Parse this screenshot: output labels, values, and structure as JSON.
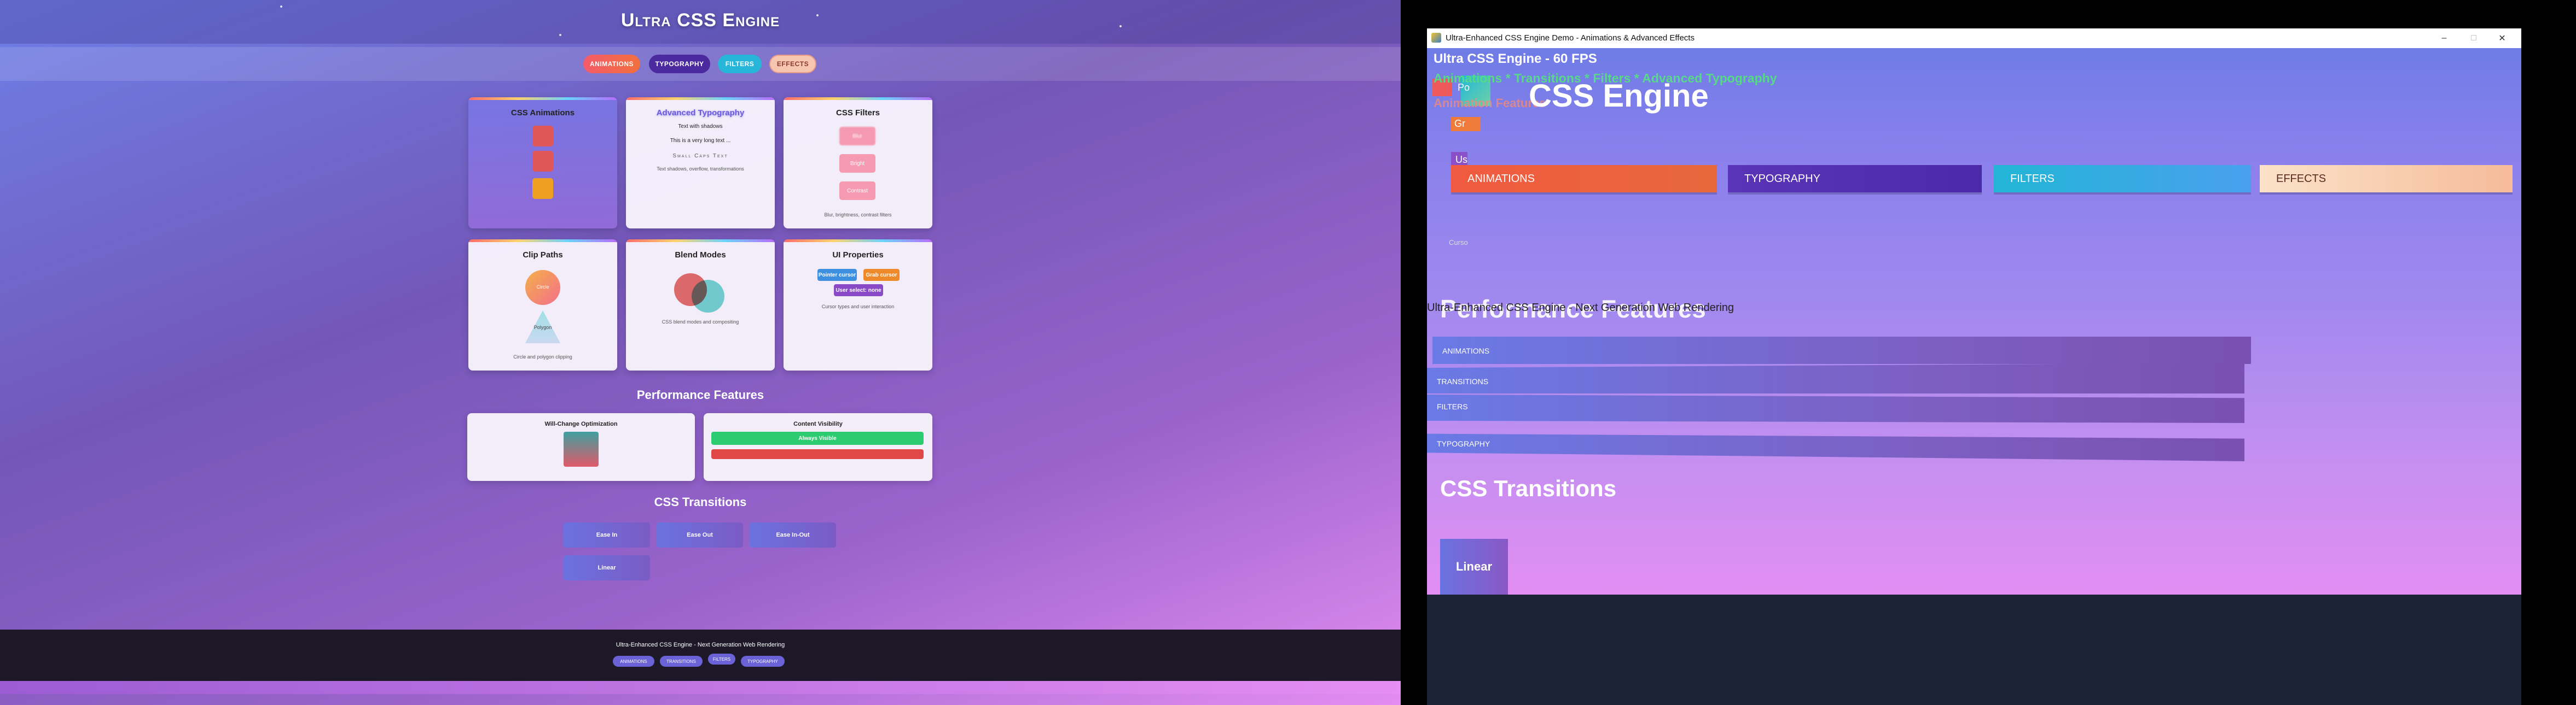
{
  "left_page": {
    "title": "Ultra CSS Engine",
    "nav": [
      "ANIMATIONS",
      "TYPOGRAPHY",
      "FILTERS",
      "EFFECTS"
    ],
    "cards": {
      "animations": {
        "title": "CSS Animations"
      },
      "typography": {
        "title": "Advanced Typography",
        "lines": [
          "Text with shadows",
          "This is a very long text ...",
          "Small Caps Text",
          "Text shadows, overflow, transformations"
        ]
      },
      "filters": {
        "title": "CSS Filters",
        "boxes": [
          "Blur",
          "Bright",
          "Contrast"
        ],
        "caption": "Blur, brightness, contrast filters"
      },
      "clip": {
        "title": "Clip Paths",
        "circle": "Circle",
        "polygon": "Polygon",
        "caption": "Circle and polygon clipping"
      },
      "blend": {
        "title": "Blend Modes",
        "caption": "CSS blend modes and compositing"
      },
      "ui": {
        "title": "UI Properties",
        "buttons": [
          "Pointer cursor",
          "Grab cursor",
          "User select: none"
        ],
        "caption": "Cursor types and user interaction"
      }
    },
    "performance": {
      "heading": "Performance Features",
      "will_change": {
        "title": "Will-Change Optimization"
      },
      "visibility": {
        "title": "Content Visibility",
        "always": "Always Visible"
      }
    },
    "transitions": {
      "heading": "CSS Transitions",
      "buttons": [
        "Ease In",
        "Ease Out",
        "Ease In-Out",
        "Linear"
      ]
    },
    "footer": {
      "text": "Ultra-Enhanced CSS Engine - Next Generation Web Rendering",
      "badges": [
        "ANIMATIONS",
        "TRANSITIONS",
        "FILTERS",
        "TYPOGRAPHY"
      ]
    }
  },
  "engine_window": {
    "window_title": "Ultra-Enhanced CSS Engine Demo - Animations & Advanced Effects",
    "controls": {
      "minimize": "–",
      "maximize": "□",
      "close": "✕"
    },
    "fps_text": "Ultra CSS Engine - 60 FPS",
    "features_line": "Animations * Transitions * Filters * Advanced Typography",
    "heading_fragment": "CSS Engine",
    "animation_fragment": "Animation Features",
    "fragments": [
      "Po",
      "Gr",
      "Us",
      "Curso"
    ],
    "tabs": [
      "ANIMATIONS",
      "TYPOGRAPHY",
      "FILTERS",
      "EFFECTS"
    ],
    "footer_text": "Ultra-Enhanced CSS Engine - Next Generation Web Rendering",
    "performance_heading": "Performance Features",
    "strips": [
      "ANIMATIONS",
      "TRANSITIONS",
      "FILTERS",
      "TYPOGRAPHY"
    ],
    "transitions_heading": "CSS Transitions",
    "linear_label": "Linear"
  }
}
